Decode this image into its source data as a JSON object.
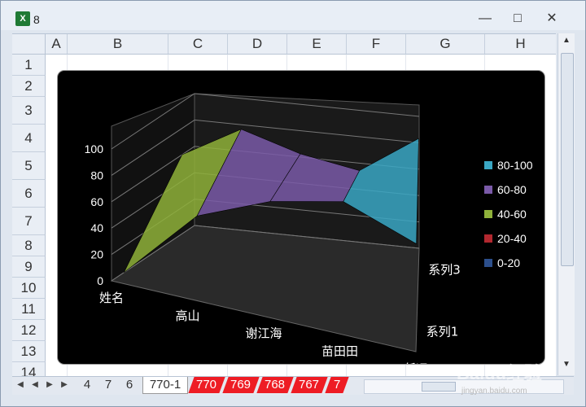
{
  "window": {
    "title": "8",
    "app_icon": "excel-icon"
  },
  "columns": [
    "A",
    "B",
    "C",
    "D",
    "E",
    "F",
    "G",
    "H"
  ],
  "rows": [
    "1",
    "2",
    "3",
    "4",
    "5",
    "6",
    "7",
    "8",
    "9",
    "10",
    "11",
    "12",
    "13",
    "14"
  ],
  "sheet_tabs": [
    "4",
    "7",
    "6",
    "770-1",
    "770",
    "769",
    "768",
    "767",
    "7"
  ],
  "active_tab": "770-1",
  "chart_data": {
    "type": "surface",
    "categories": [
      "姓名",
      "高山",
      "谢江海",
      "苗田田",
      "任远"
    ],
    "series_axis": [
      "系列1",
      "系列3"
    ],
    "y_ticks": [
      "0",
      "20",
      "40",
      "60",
      "80",
      "100"
    ],
    "ylim": [
      0,
      100
    ],
    "legend": [
      {
        "label": "80-100",
        "color": "#3aa7c4"
      },
      {
        "label": "60-80",
        "color": "#7a5aa8"
      },
      {
        "label": "40-60",
        "color": "#8fb13a"
      },
      {
        "label": "20-40",
        "color": "#b2282f"
      },
      {
        "label": "0-20",
        "color": "#2c4f8c"
      }
    ],
    "series": [
      {
        "name": "系列1",
        "values": [
          0,
          55,
          78,
          90,
          70
        ]
      },
      {
        "name": "系列3",
        "values": [
          60,
          85,
          72,
          65,
          95
        ]
      }
    ],
    "legend_placement": "right"
  },
  "watermark": {
    "text": "Baidu经验",
    "sub": "jingyan.baidu.com"
  }
}
